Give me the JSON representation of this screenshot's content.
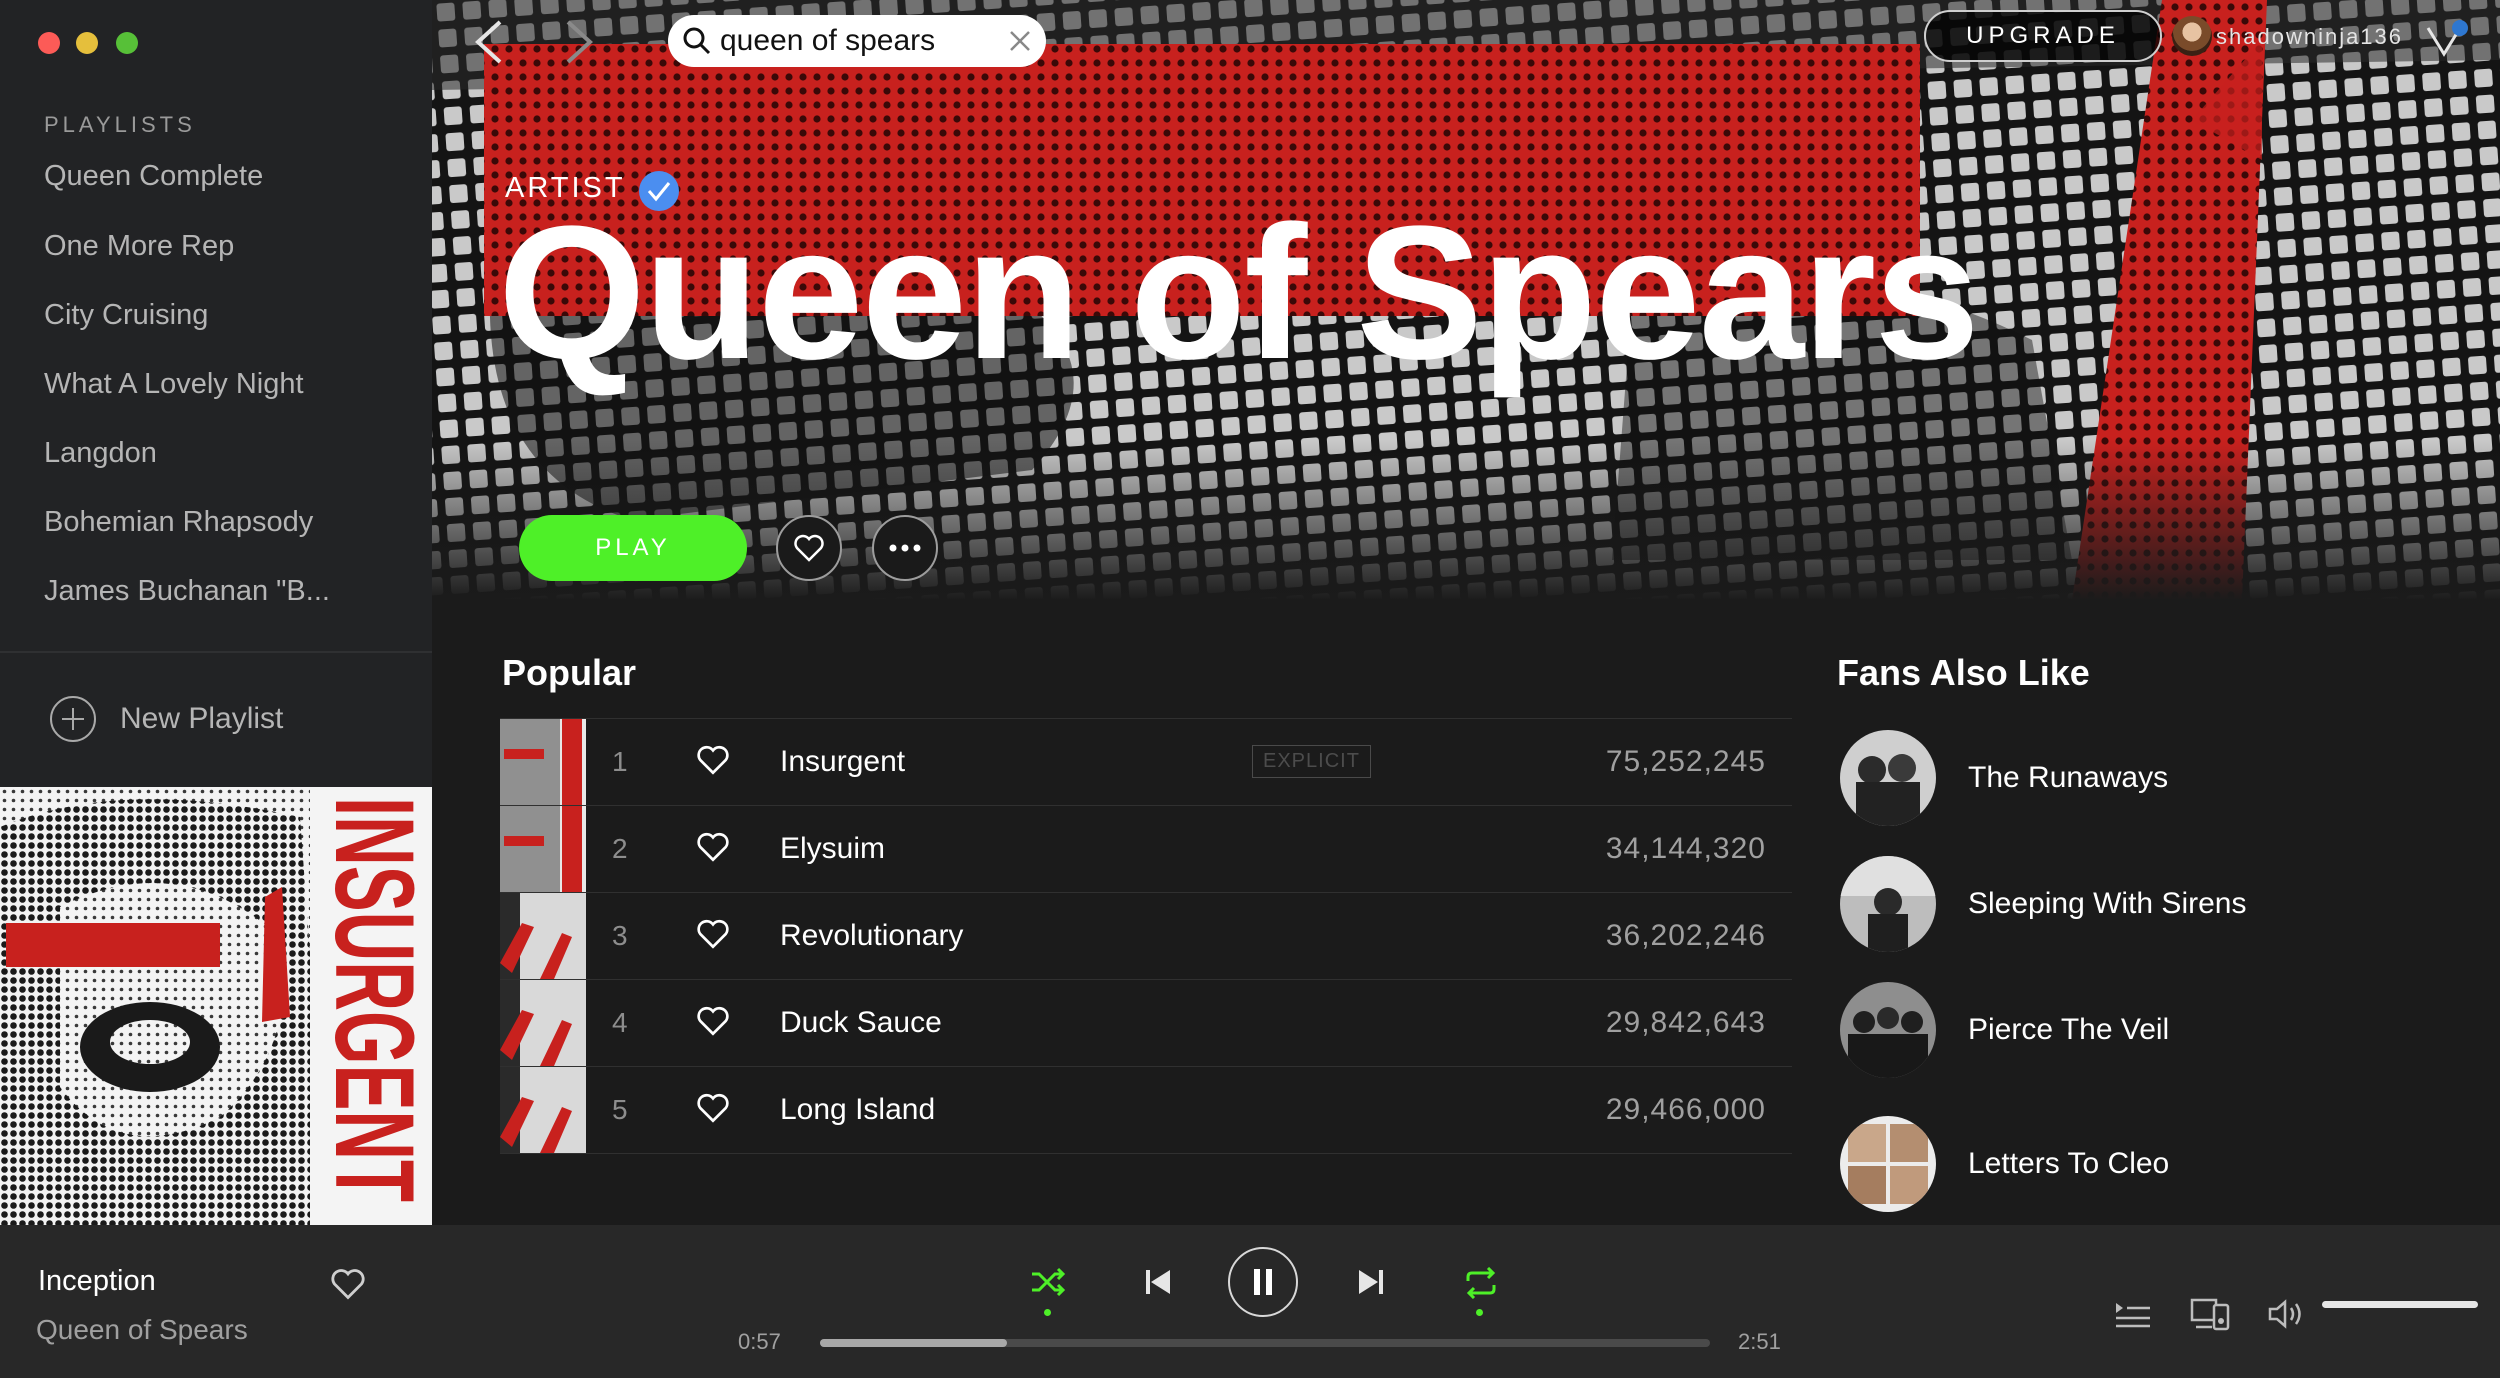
{
  "sidebar": {
    "heading": "PLAYLISTS",
    "playlists": [
      "Queen Complete",
      "One More Rep",
      "City Cruising",
      "What A Lovely Night",
      "Langdon",
      "Bohemian Rhapsody",
      "James Buchanan \"B..."
    ],
    "new_playlist": "New Playlist",
    "album_art_text": "INSURGENT"
  },
  "topbar": {
    "search_value": "queen of spears",
    "upgrade_label": "UPGRADE",
    "username": "shadowninja136"
  },
  "artist": {
    "label": "ARTIST",
    "name": "Queen of Spears",
    "play_label": "PLAY"
  },
  "popular": {
    "title": "Popular",
    "tracks": [
      {
        "num": "1",
        "title": "Insurgent",
        "explicit": "EXPLICIT",
        "plays": "75,252,245"
      },
      {
        "num": "2",
        "title": "Elysuim",
        "explicit": "",
        "plays": "34,144,320"
      },
      {
        "num": "3",
        "title": "Revolutionary",
        "explicit": "",
        "plays": "36,202,246"
      },
      {
        "num": "4",
        "title": "Duck Sauce",
        "explicit": "",
        "plays": "29,842,643"
      },
      {
        "num": "5",
        "title": "Long Island",
        "explicit": "",
        "plays": "29,466,000"
      }
    ]
  },
  "fans": {
    "title": "Fans Also Like",
    "artists": [
      "The Runaways",
      "Sleeping With Sirens",
      "Pierce The Veil",
      "Letters To Cleo"
    ]
  },
  "player": {
    "track_title": "Inception",
    "track_artist": "Queen of Spears",
    "elapsed": "0:57",
    "total": "2:51",
    "progress": 0.21,
    "volume": 1.0
  },
  "colors": {
    "accent_green": "#4ef028",
    "verified_blue": "#4b8ef0",
    "hero_red": "#c8211e"
  },
  "icons": {
    "back": "chevron-left-icon",
    "forward": "chevron-right-icon",
    "search": "search-icon",
    "clear": "close-icon",
    "verified": "verified-check-icon",
    "heart": "heart-icon",
    "more": "more-dots-icon",
    "shuffle": "shuffle-icon",
    "previous": "skip-previous-icon",
    "pause": "pause-icon",
    "next": "skip-next-icon",
    "repeat": "repeat-icon",
    "queue": "queue-icon",
    "devices": "devices-icon",
    "volume": "volume-icon"
  }
}
